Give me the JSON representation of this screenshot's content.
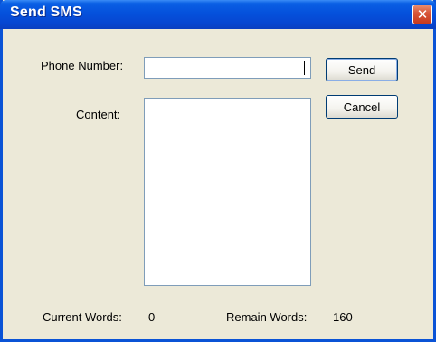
{
  "window": {
    "title": "Send SMS",
    "close_glyph": "✕",
    "close_icon": "close-icon",
    "title_color": "#0551dc",
    "close_color": "#d8573a"
  },
  "form": {
    "phone_label": "Phone Number:",
    "phone_value": "",
    "content_label": "Content:",
    "content_value": ""
  },
  "buttons": {
    "send_label": "Send",
    "cancel_label": "Cancel"
  },
  "footer": {
    "current_words_label": "Current Words:",
    "current_words_value": "0",
    "remain_words_label": "Remain Words:",
    "remain_words_value": "160"
  }
}
